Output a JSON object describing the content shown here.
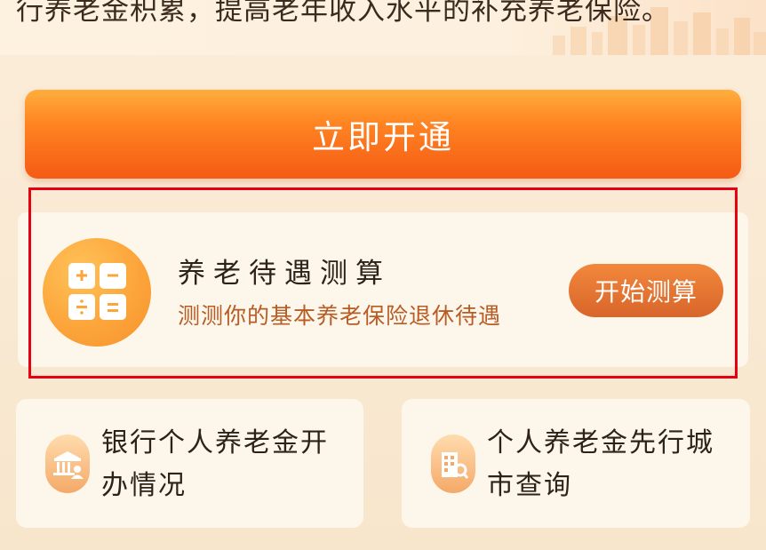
{
  "intro": {
    "text": "行养老金积累，提高老年收入水平的补充养老保险。"
  },
  "cta": {
    "label": "立即开通"
  },
  "calculator": {
    "title": "养老待遇测算",
    "subtitle": "测测你的基本养老保险退休待遇",
    "button_label": "开始测算",
    "icon": "calculator-icon"
  },
  "links": [
    {
      "label": "银行个人养老金开办情况",
      "icon": "bank-user-icon"
    },
    {
      "label": "个人养老金先行城市查询",
      "icon": "city-search-icon"
    }
  ],
  "colors": {
    "cta_gradient_top": "#ffae3c",
    "cta_gradient_bottom": "#f55a14",
    "highlight_border": "#e60012",
    "subtitle_text": "#b85c25",
    "start_button": "#e0702f",
    "icon_orange": "#fca53b"
  }
}
